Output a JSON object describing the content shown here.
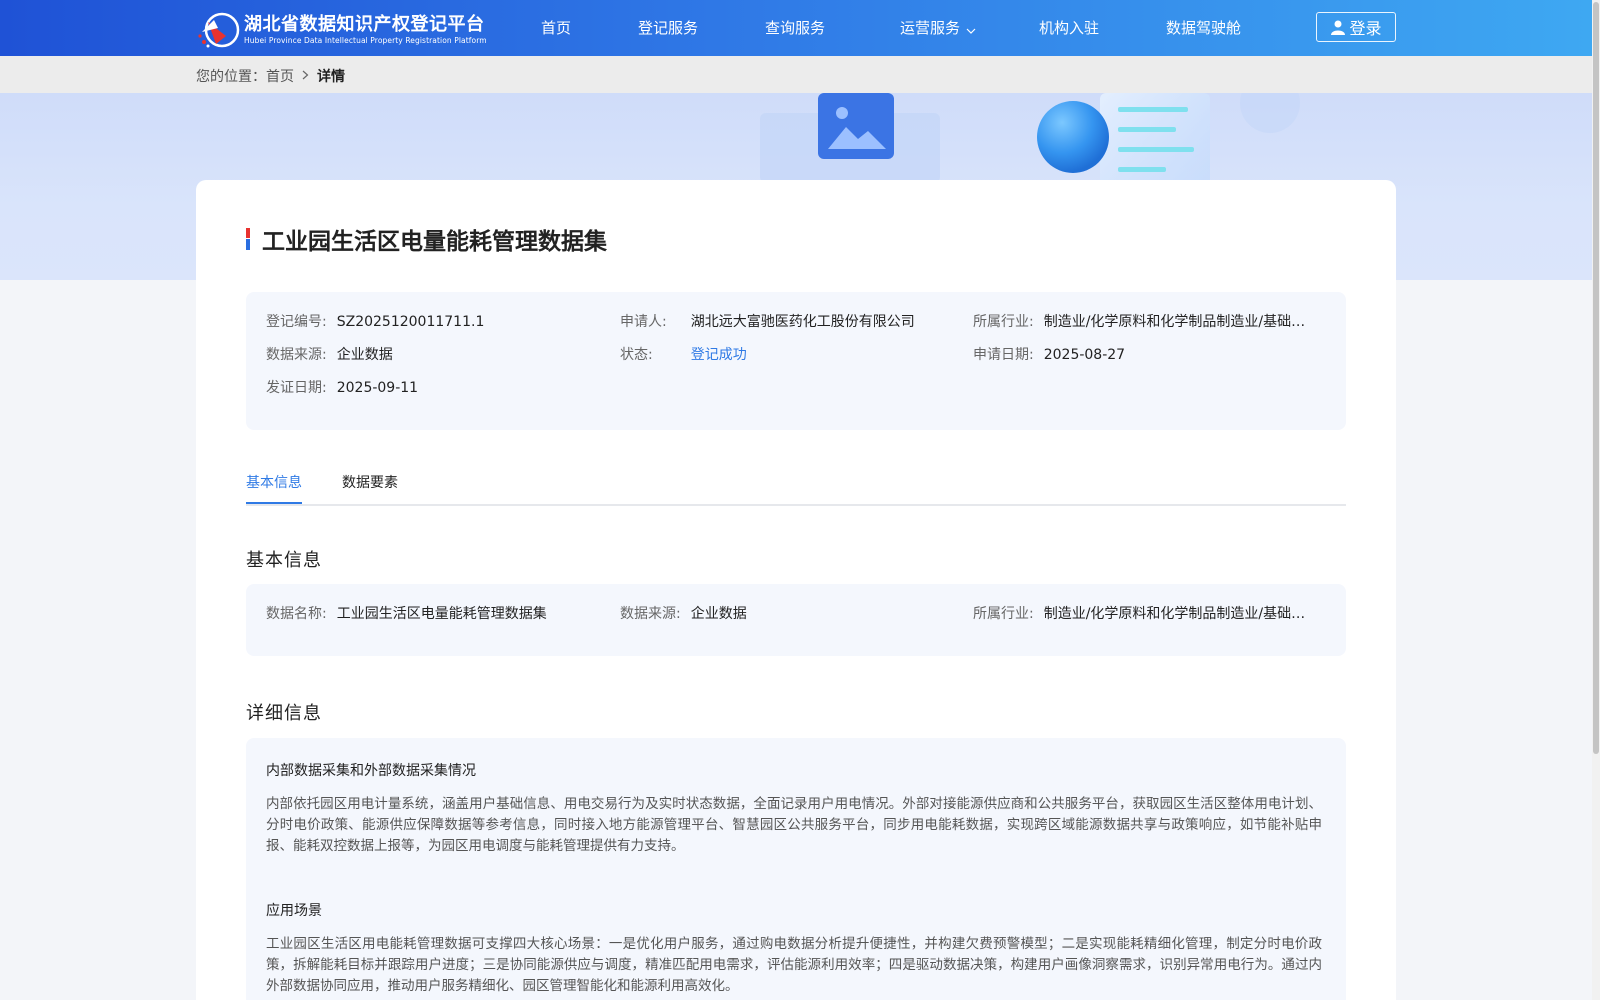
{
  "header": {
    "logo_cn": "湖北省数据知识产权登记平台",
    "logo_en": "Hubei Province Data Intellectual Property Registration Platform",
    "nav": [
      {
        "label": "首页"
      },
      {
        "label": "登记服务"
      },
      {
        "label": "查询服务"
      },
      {
        "label": "运营服务"
      },
      {
        "label": "机构入驻"
      },
      {
        "label": "数据驾驶舱"
      }
    ],
    "login_label": "登录"
  },
  "breadcrumb": {
    "prefix": "您的位置：",
    "home": "首页",
    "current": "详情"
  },
  "page": {
    "title": "工业园生活区电量能耗管理数据集"
  },
  "summary": {
    "reg_no_label": "登记编号:",
    "reg_no": "SZ2025120011711.1",
    "applicant_label": "申请人:",
    "applicant": "湖北远大富驰医药化工股份有限公司",
    "industry_label": "所属行业:",
    "industry": "制造业/化学原料和化学制品制造业/基础化学原料制造",
    "source_label": "数据来源:",
    "source": "企业数据",
    "status_label": "状态:",
    "status": "登记成功",
    "apply_date_label": "申请日期:",
    "apply_date": "2025-08-27",
    "cert_date_label": "发证日期:",
    "cert_date": "2025-09-11"
  },
  "tabs": [
    {
      "label": "基本信息",
      "active": true
    },
    {
      "label": "数据要素",
      "active": false
    }
  ],
  "basic": {
    "section_title": "基本信息",
    "name_label": "数据名称:",
    "name": "工业园生活区电量能耗管理数据集",
    "source_label": "数据来源:",
    "source": "企业数据",
    "industry_label": "所属行业:",
    "industry": "制造业/化学原料和化学制品制造业/基础化学原料制造"
  },
  "detail": {
    "section_title": "详细信息",
    "collect_title": "内部数据采集和外部数据采集情况",
    "collect_text": "内部依托园区用电计量系统，涵盖用户基础信息、用电交易行为及实时状态数据，全面记录用户用电情况。外部对接能源供应商和公共服务平台，获取园区生活区整体用电计划、分时电价政策、能源供应保障数据等参考信息，同时接入地方能源管理平台、智慧园区公共服务平台，同步用电能耗数据，实现跨区域能源数据共享与政策响应，如节能补贴申报、能耗双控数据上报等，为园区用电调度与能耗管理提供有力支持。",
    "scene_title": "应用场景",
    "scene_text": "工业园区生活区用电能耗管理数据可支撑四大核心场景：一是优化用户服务，通过购电数据分析提升便捷性，并构建欠费预警模型；二是实现能耗精细化管理，制定分时电价政策，拆解能耗目标并跟踪用户进度；三是协同能源供应与调度，精准匹配用电需求，评估能源利用效率；四是驱动数据决策，构建用户画像洞察需求，识别异常用电行为。通过内外部数据协同应用，推动用户服务精细化、园区管理智能化和能源利用高效化。"
  },
  "colors": {
    "header_start": "#1f52d6",
    "header_end": "#3ea8f2",
    "accent": "#2f7ae5",
    "title_mark_red": "#e8322f",
    "panel_bg": "#f4f7fd"
  }
}
